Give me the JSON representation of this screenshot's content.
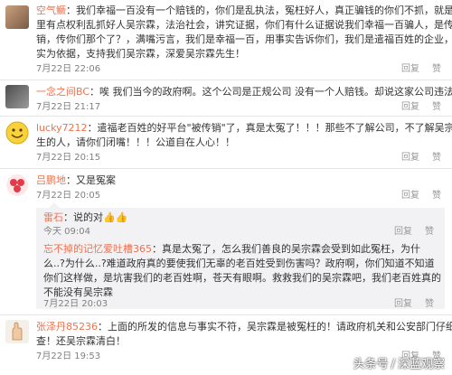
{
  "comments": [
    {
      "username": "空气鳜",
      "lines": [
        "空气鳜：我们幸福一百没有一个赔钱的，你们是乱执法，冤枉好人，真正骗钱的你们不抓，就是手",
        "里有点权利乱抓好人吴宗霖，法治社会，讲究证据，你们有什么证据说我们幸福一百骗人，是传",
        "销，传你们那个了？，满嘴污言，我们是幸福一百，用事实告诉你们，我们是遣福百姓的企业，以事",
        "实为依据，支持我们吴宗霖，深爱吴宗霖先生！"
      ],
      "time": "7月22日 22:06",
      "actions": [
        "回复",
        "赞"
      ]
    },
    {
      "username": "一念之间BC",
      "lines": [
        "一念之间BC：唉 我们当今的政府啊。这个公司是正规公司 没有一个人赔钱。却说这家公司违法"
      ],
      "time": "7月22日 21:17",
      "actions": [
        "回复",
        "赞"
      ]
    },
    {
      "username": "lucky7212",
      "lines": [
        "lucky7212：遣福老百姓的好平台\"被传销\"了，真是太冤了！！！那些不了解公司，不了解吴宗霖先",
        "生的人，请你们闭嘴！！！公道自在人心！！"
      ],
      "time": "7月22日 20:15",
      "actions": [
        "回复",
        "赞"
      ]
    },
    {
      "username": "吕鹏地",
      "lines": [
        "吕鹏地：又是冤案"
      ],
      "time": "7月22日 20:05",
      "actions": [
        "回复",
        "赞"
      ]
    },
    {
      "username": "雷石",
      "lines": [
        "雷石：说的对👍👍"
      ],
      "time": "今天 09:04",
      "actions": [
        "回复",
        "赞"
      ]
    },
    {
      "username": "忘不掉的记忆爱吐槽365",
      "lines": [
        "忘不掉的记忆爱吐槽365：真是太冤了，怎么我们善良的吴宗霖会受到如此冤枉，为什",
        "么..?为什么..?难道政府真的要使我们无辜的老百姓受到伤害吗？政府啊，你们知道不知道",
        "你们这样做，是坑害我们的老百姓啊，苍天有眼啊。救救我们的吴宗霖吧，我们老百姓真的",
        "不能没有吴宗霖"
      ],
      "time": "7月22日 20:03",
      "actions": [
        "回复",
        "赞"
      ]
    },
    {
      "username": "张泽丹85236",
      "lines": [
        "张泽丹85236：上面的所发的信息与事实不符，吴宗霖是被冤枉的！请政府机关和公安部门仔细调",
        "查！还吴宗霖清白！"
      ],
      "time": "7月22日 19:53",
      "actions": [
        "回复",
        "赞"
      ]
    }
  ],
  "watermark": {
    "brand": "头条号",
    "separator": "/",
    "channel": "深蓝观察"
  },
  "colors": {
    "username": "#eb7350",
    "text": "#333333",
    "meta": "#808080",
    "reply_bg": "#f2f2f5"
  }
}
